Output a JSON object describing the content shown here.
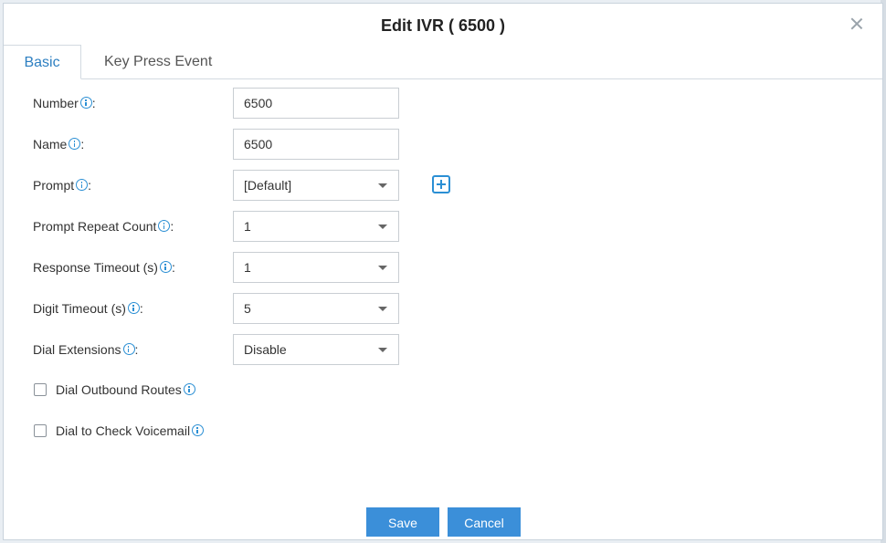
{
  "dialog": {
    "title": "Edit IVR ( 6500 )"
  },
  "tabs": [
    {
      "label": "Basic",
      "active": true
    },
    {
      "label": "Key Press Event",
      "active": false
    }
  ],
  "form": {
    "number": {
      "label": "Number",
      "value": "6500"
    },
    "name": {
      "label": "Name",
      "value": "6500"
    },
    "prompt": {
      "label": "Prompt",
      "value": "[Default]"
    },
    "prompt_repeat_count": {
      "label": "Prompt Repeat Count",
      "value": "1"
    },
    "response_timeout": {
      "label": "Response Timeout (s)",
      "value": "1"
    },
    "digit_timeout": {
      "label": "Digit Timeout (s)",
      "value": "5"
    },
    "dial_extensions": {
      "label": "Dial Extensions",
      "value": "Disable"
    },
    "dial_outbound_routes": {
      "label": "Dial Outbound Routes",
      "checked": false
    },
    "dial_check_voicemail": {
      "label": "Dial to Check Voicemail",
      "checked": false
    }
  },
  "buttons": {
    "save": "Save",
    "cancel": "Cancel"
  },
  "colors": {
    "accent": "#2d7fc1",
    "button": "#3b8fd9",
    "info_icon": "#2b8fd4"
  }
}
